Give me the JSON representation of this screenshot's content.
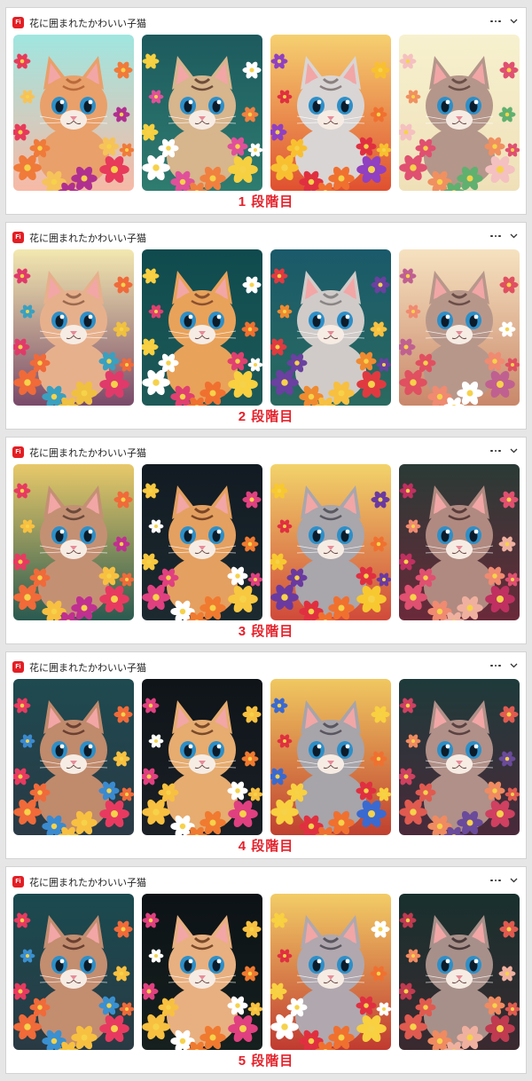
{
  "app_badge": "Fi",
  "panels": [
    {
      "title": "花に囲まれたかわいい子猫",
      "stage_label": "1 段階目",
      "thumbs": [
        {
          "bg_top": "#9fe6e0",
          "bg_bottom": "#f7b9a6",
          "fur": "#e9a06a",
          "fur_dark": "#b96a3a",
          "flowers": [
            "#e83a5a",
            "#f07a3a",
            "#f6c35a",
            "#b03090"
          ]
        },
        {
          "bg_top": "#1d5a5e",
          "bg_bottom": "#2f7c70",
          "fur": "#d7b58d",
          "fur_dark": "#6d4c3a",
          "flowers": [
            "#f08040",
            "#f6d040",
            "#ffffff",
            "#e0509a"
          ]
        },
        {
          "bg_top": "#f5d070",
          "bg_bottom": "#e05030",
          "fur": "#d9d5d4",
          "fur_dark": "#8a8080",
          "flowers": [
            "#e03040",
            "#f07030",
            "#9040c0",
            "#f8c030"
          ]
        },
        {
          "bg_top": "#f7f1cf",
          "bg_bottom": "#efe0b8",
          "fur": "#b4968a",
          "fur_dark": "#6a5048",
          "flowers": [
            "#e05070",
            "#f09060",
            "#60b070",
            "#f5c0c0"
          ]
        }
      ]
    },
    {
      "title": "花に囲まれたかわいい子猫",
      "stage_label": "2 段階目",
      "thumbs": [
        {
          "bg_top": "#f3e8b0",
          "bg_bottom": "#7a4a6a",
          "fur": "#e7b08c",
          "fur_dark": "#9a6a50",
          "flowers": [
            "#e03a6a",
            "#f06a3a",
            "#3aa0c0",
            "#f0c040"
          ]
        },
        {
          "bg_top": "#0f4a4e",
          "bg_bottom": "#1f5a58",
          "fur": "#e9a25a",
          "fur_dark": "#8a5030",
          "flowers": [
            "#f07030",
            "#f8d040",
            "#ffffff",
            "#e04070"
          ]
        },
        {
          "bg_top": "#1a5a6a",
          "bg_bottom": "#2a6a60",
          "fur": "#d0cbc8",
          "fur_dark": "#8a8585",
          "flowers": [
            "#f08a30",
            "#f8c040",
            "#e03a40",
            "#6a40a0"
          ]
        },
        {
          "bg_top": "#f6e2c0",
          "bg_bottom": "#c9876a",
          "fur": "#b8978b",
          "fur_dark": "#6b4e48",
          "flowers": [
            "#e05060",
            "#f08a70",
            "#ffffff",
            "#c06090"
          ]
        }
      ]
    },
    {
      "title": "花に囲まれたかわいい子猫",
      "stage_label": "3 段階目",
      "thumbs": [
        {
          "bg_top": "#e8c96a",
          "bg_bottom": "#2a5a50",
          "fur": "#c49074",
          "fur_dark": "#6a4a3a",
          "flowers": [
            "#e83a60",
            "#f06a3a",
            "#f8c040",
            "#c03090"
          ]
        },
        {
          "bg_top": "#121a22",
          "bg_bottom": "#1c2a30",
          "fur": "#e4a060",
          "fur_dark": "#7a4628",
          "flowers": [
            "#f07a30",
            "#f8c840",
            "#e04080",
            "#ffffff"
          ]
        },
        {
          "bg_top": "#f2d36a",
          "bg_bottom": "#d04a3a",
          "fur": "#a9a6ac",
          "fur_dark": "#5a5860",
          "flowers": [
            "#e03040",
            "#f07030",
            "#f8c830",
            "#6a3aa0"
          ]
        },
        {
          "bg_top": "#2a3a36",
          "bg_bottom": "#6a2a3a",
          "fur": "#b08a80",
          "fur_dark": "#5a3c3a",
          "flowers": [
            "#e05070",
            "#f08a70",
            "#f0b0a0",
            "#c03060"
          ]
        }
      ]
    },
    {
      "title": "花に囲まれたかわいい子猫",
      "stage_label": "4 段階目",
      "thumbs": [
        {
          "bg_top": "#1e4a50",
          "bg_bottom": "#2a3a46",
          "fur": "#c08a6c",
          "fur_dark": "#6a4032",
          "flowers": [
            "#e83a60",
            "#f06a3a",
            "#3a8ad0",
            "#f8c040"
          ]
        },
        {
          "bg_top": "#0e1418",
          "bg_bottom": "#1a2026",
          "fur": "#e6ac70",
          "fur_dark": "#7a4a2a",
          "flowers": [
            "#f07a30",
            "#e04080",
            "#f8c040",
            "#ffffff"
          ]
        },
        {
          "bg_top": "#f0c860",
          "bg_bottom": "#c04030",
          "fur": "#a7a4aa",
          "fur_dark": "#5a5660",
          "flowers": [
            "#e03040",
            "#f07030",
            "#3a6ad0",
            "#f8d040"
          ]
        },
        {
          "bg_top": "#1e3a3a",
          "bg_bottom": "#4a2a3a",
          "fur": "#b09088",
          "fur_dark": "#5a4242",
          "flowers": [
            "#e05a50",
            "#f08a60",
            "#6a4a9a",
            "#d04060"
          ]
        }
      ]
    },
    {
      "title": "花に囲まれたかわいい子猫",
      "stage_label": "5 段階目",
      "thumbs": [
        {
          "bg_top": "#1a4a50",
          "bg_bottom": "#2a3a44",
          "fur": "#c38d70",
          "fur_dark": "#6a4030",
          "flowers": [
            "#e83a60",
            "#f06a3a",
            "#3a90d0",
            "#f8c040"
          ]
        },
        {
          "bg_top": "#0c1216",
          "bg_bottom": "#16201e",
          "fur": "#e8b080",
          "fur_dark": "#7a4a2a",
          "flowers": [
            "#f07a30",
            "#e04080",
            "#f8c040",
            "#ffffff"
          ]
        },
        {
          "bg_top": "#f2cc66",
          "bg_bottom": "#c03a30",
          "fur": "#b0a8ae",
          "fur_dark": "#5a5660",
          "flowers": [
            "#e03040",
            "#f07030",
            "#f8d040",
            "#ffffff"
          ]
        },
        {
          "bg_top": "#18302e",
          "bg_bottom": "#3a2a30",
          "fur": "#a8908a",
          "fur_dark": "#4a3a3a",
          "flowers": [
            "#e05a50",
            "#f08a60",
            "#f0b0a0",
            "#c03a50"
          ]
        }
      ]
    }
  ]
}
